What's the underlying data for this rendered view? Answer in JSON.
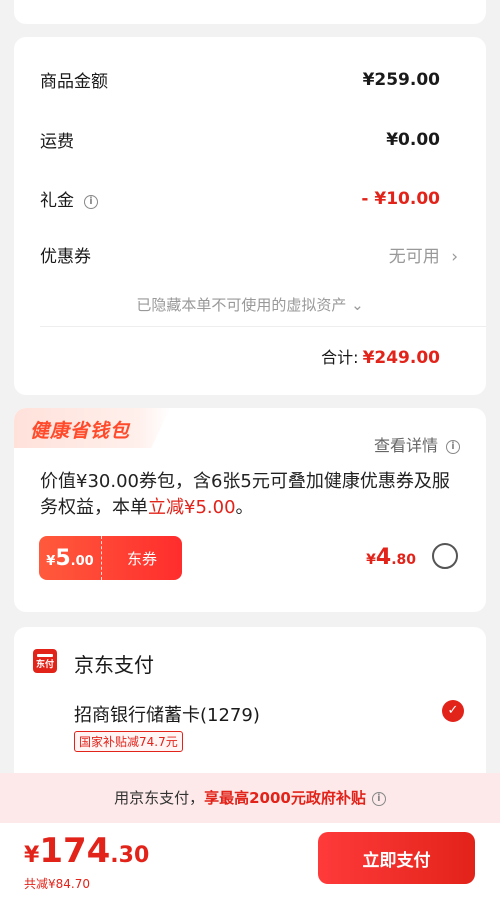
{
  "price_summary": {
    "goods_label": "商品金额",
    "goods_value": "¥259.00",
    "shipping_label": "运费",
    "shipping_value": "¥0.00",
    "gift_label": "礼金",
    "gift_value": "- ¥10.00",
    "coupon_label": "优惠券",
    "coupon_value": "无可用",
    "hidden_assets": "已隐藏本单不可使用的虚拟资产",
    "total_label": "合计:",
    "total_value": "¥249.00"
  },
  "health_wallet": {
    "title": "健康省钱包",
    "view_detail": "查看详情",
    "desc_prefix": "价值¥30.00券包，含6张5元可叠加健康优惠券及服务权益，本单",
    "desc_highlight": "立减¥5.00",
    "desc_suffix": "。",
    "coupon_symbol": "¥",
    "coupon_int": "5",
    "coupon_dec": ".00",
    "coupon_tag": "东券",
    "price_symbol": "¥",
    "price_int": "4",
    "price_dec": ".80"
  },
  "payment": {
    "method_title": "京东支付",
    "icon_text": "东付",
    "bank_card": "招商银行储蓄卡(1279)",
    "subsidy_tag": "国家补贴减74.7元"
  },
  "gov_banner": {
    "prefix": "用京东支付，",
    "highlight": "享最高2000元政府补贴"
  },
  "bottom_bar": {
    "total_symbol": "¥",
    "total_int": "174",
    "total_dec": ".30",
    "saved": "共减¥84.70",
    "pay_button": "立即支付"
  },
  "colors": {
    "accent": "#e2231a",
    "banner_bg": "#fde9ea",
    "page_bg": "#f2f2f2"
  }
}
